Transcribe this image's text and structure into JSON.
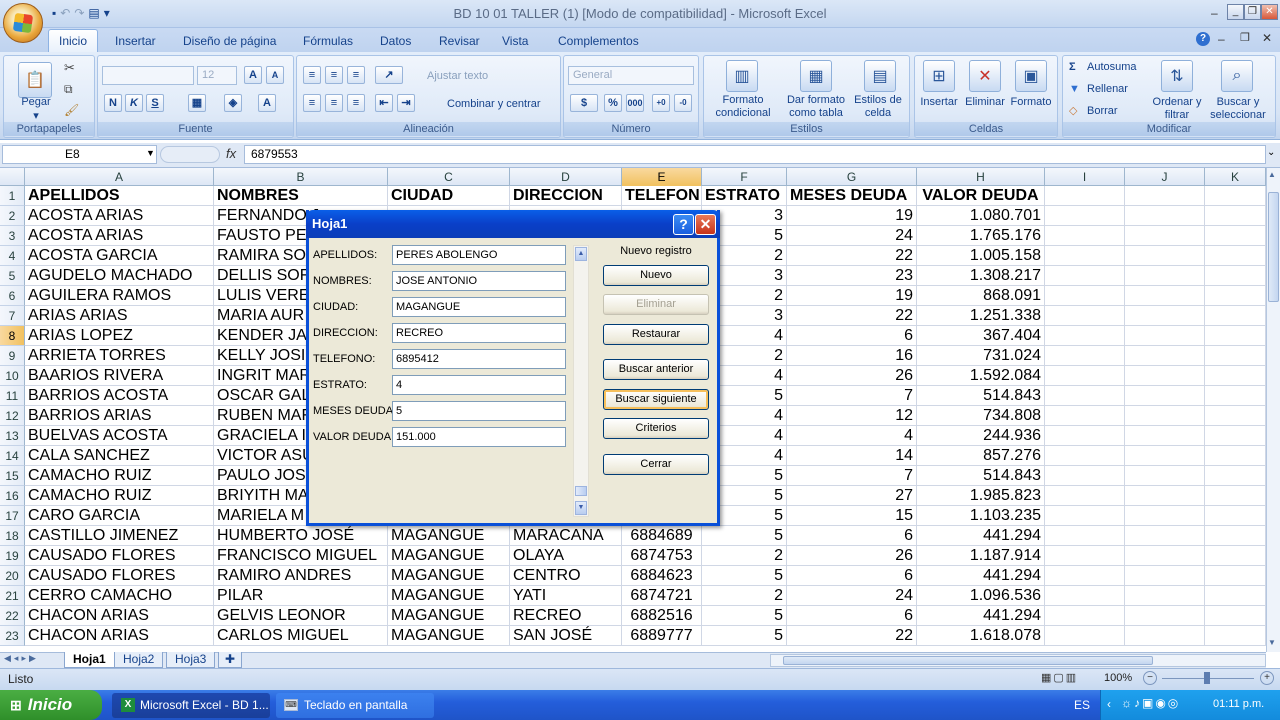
{
  "window": {
    "title": "BD 10 01 TALLER (1)  [Modo de compatibilidad] - Microsoft Excel"
  },
  "ribbon_tabs": [
    "Inicio",
    "Insertar",
    "Diseño de página",
    "Fórmulas",
    "Datos",
    "Revisar",
    "Vista",
    "Complementos"
  ],
  "ribbon": {
    "clipboard": {
      "paste": "Pegar",
      "label": "Portapapeles"
    },
    "font": {
      "font_name": "",
      "font_size": "12",
      "label": "Fuente"
    },
    "alignment": {
      "wrap": "Ajustar texto",
      "merge": "Combinar y centrar",
      "label": "Alineación"
    },
    "number": {
      "format": "General",
      "label": "Número"
    },
    "styles": {
      "cond_format": "Formato condicional",
      "table_format": "Dar formato como tabla",
      "cell_styles": "Estilos de celda",
      "label": "Estilos"
    },
    "cells": {
      "insert": "Insertar",
      "delete": "Eliminar",
      "format": "Formato",
      "label": "Celdas"
    },
    "editing": {
      "autosum": "Autosuma",
      "fill": "Rellenar",
      "clear": "Borrar",
      "sort": "Ordenar y filtrar",
      "find": "Buscar y seleccionar",
      "label": "Modificar"
    }
  },
  "formula_bar": {
    "name_box": "E8",
    "fx": "fx",
    "formula": "6879553"
  },
  "columns": [
    "A",
    "B",
    "C",
    "D",
    "E",
    "F",
    "G",
    "H",
    "I",
    "J",
    "K"
  ],
  "rows": [
    [
      "1",
      "APELLIDOS",
      "NOMBRES",
      "CIUDAD",
      "DIRECCION",
      "TELEFON",
      "ESTRATO",
      "MESES DEUDA",
      "VALOR DEUDA"
    ],
    [
      "2",
      "ACOSTA ARIAS",
      "FERNANDO J",
      "",
      "",
      "",
      "3",
      "19",
      "1.080.701"
    ],
    [
      "3",
      "ACOSTA ARIAS",
      "FAUSTO PE",
      "",
      "",
      "",
      "5",
      "24",
      "1.765.176"
    ],
    [
      "4",
      "ACOSTA GARCIA",
      "RAMIRA SO",
      "",
      "",
      "",
      "2",
      "22",
      "1.005.158"
    ],
    [
      "5",
      "AGUDELO MACHADO",
      "DELLIS SOF",
      "",
      "",
      "",
      "3",
      "23",
      "1.308.217"
    ],
    [
      "6",
      "AGUILERA RAMOS",
      "LULIS VERE",
      "",
      "",
      "",
      "2",
      "19",
      "868.091"
    ],
    [
      "7",
      "ARIAS ARIAS",
      "MARIA AUR",
      "",
      "",
      "",
      "3",
      "22",
      "1.251.338"
    ],
    [
      "8",
      "ARIAS LOPEZ",
      "KENDER JA",
      "",
      "",
      "",
      "4",
      "6",
      "367.404"
    ],
    [
      "9",
      "ARRIETA TORRES",
      "KELLY JOSI",
      "",
      "",
      "",
      "2",
      "16",
      "731.024"
    ],
    [
      "10",
      "BAARIOS RIVERA",
      "INGRIT MAR",
      "",
      "",
      "",
      "4",
      "26",
      "1.592.084"
    ],
    [
      "11",
      "BARRIOS ACOSTA",
      "OSCAR GAL",
      "",
      "",
      "",
      "5",
      "7",
      "514.843"
    ],
    [
      "12",
      "BARRIOS ARIAS",
      "RUBEN MAF",
      "",
      "",
      "",
      "4",
      "12",
      "734.808"
    ],
    [
      "13",
      "BUELVAS ACOSTA",
      "GRACIELA I",
      "",
      "",
      "",
      "4",
      "4",
      "244.936"
    ],
    [
      "14",
      "CALA SANCHEZ",
      "VICTOR ASU",
      "",
      "",
      "",
      "4",
      "14",
      "857.276"
    ],
    [
      "15",
      "CAMACHO RUIZ",
      "PAULO JOS",
      "",
      "",
      "",
      "5",
      "7",
      "514.843"
    ],
    [
      "16",
      "CAMACHO RUIZ",
      "BRIYITH MA",
      "",
      "",
      "",
      "5",
      "27",
      "1.985.823"
    ],
    [
      "17",
      "CARO GARCIA",
      "MARIELA M",
      "",
      "",
      "",
      "5",
      "15",
      "1.103.235"
    ],
    [
      "18",
      "CASTILLO JIMENEZ",
      "HUMBERTO JOSÉ",
      "MAGANGUE",
      "MARACANA",
      "6884689",
      "5",
      "6",
      "441.294"
    ],
    [
      "19",
      "CAUSADO FLORES",
      "FRANCISCO MIGUEL",
      "MAGANGUE",
      "OLAYA",
      "6874753",
      "2",
      "26",
      "1.187.914"
    ],
    [
      "20",
      "CAUSADO FLORES",
      "RAMIRO ANDRES",
      "MAGANGUE",
      "CENTRO",
      "6884623",
      "5",
      "6",
      "441.294"
    ],
    [
      "21",
      "CERRO CAMACHO",
      "PILAR",
      "MAGANGUE",
      "YATI",
      "6874721",
      "2",
      "24",
      "1.096.536"
    ],
    [
      "22",
      "CHACON ARIAS",
      "GELVIS LEONOR",
      "MAGANGUE",
      "RECREO",
      "6882516",
      "5",
      "6",
      "441.294"
    ],
    [
      "23",
      "CHACON ARIAS",
      "CARLOS MIGUEL",
      "MAGANGUE",
      "SAN JOSÉ",
      "6889777",
      "5",
      "22",
      "1.618.078"
    ]
  ],
  "sheet_tabs": [
    "Hoja1",
    "Hoja2",
    "Hoja3"
  ],
  "status": {
    "ready": "Listo",
    "zoom": "100%"
  },
  "dialog": {
    "title": "Hoja1",
    "record_label": "Nuevo registro",
    "fields": [
      {
        "label": "APELLIDOS:",
        "value": "PERES ABOLENGO"
      },
      {
        "label": "NOMBRES:",
        "value": "JOSE ANTONIO"
      },
      {
        "label": "CIUDAD:",
        "value": "MAGANGUE"
      },
      {
        "label": "DIRECCION:",
        "value": "RECREO"
      },
      {
        "label": "TELEFONO:",
        "value": "6895412"
      },
      {
        "label": "ESTRATO:",
        "value": "4"
      },
      {
        "label": "MESES DEUDA:",
        "value": "5"
      },
      {
        "label": "VALOR DEUDA:",
        "value": "151.000"
      }
    ],
    "buttons": {
      "new": "Nuevo",
      "delete": "Eliminar",
      "restore": "Restaurar",
      "prev": "Buscar anterior",
      "next": "Buscar siguiente",
      "criteria": "Criterios",
      "close": "Cerrar"
    }
  },
  "taskbar": {
    "start": "Inicio",
    "items": [
      "Microsoft Excel - BD 1...",
      "Teclado en pantalla"
    ],
    "lang": "ES",
    "clock": "01:11 p.m."
  }
}
